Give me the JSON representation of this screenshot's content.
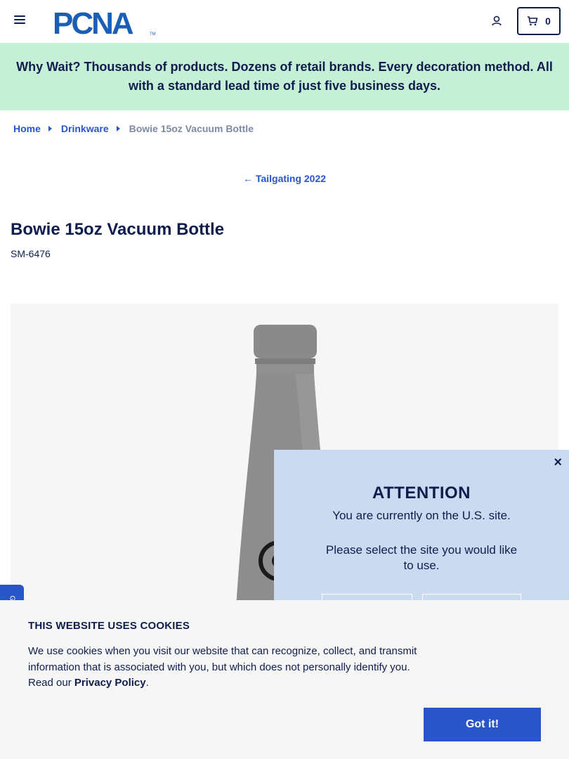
{
  "header": {
    "menu_icon": "hamburger-menu-icon",
    "logo_text": "PCNA",
    "account_icon": "user-account-icon",
    "cart_icon": "shopping-cart-icon",
    "cart_count": "0"
  },
  "banner": {
    "text": "Why Wait? Thousands of products. Dozens of retail brands. Every decoration method. All with a standard lead time of just five business days."
  },
  "breadcrumb": {
    "items": [
      "Home",
      "Drinkware"
    ],
    "current": "Bowie 15oz Vacuum Bottle"
  },
  "back_link": {
    "arrow": "←",
    "label": "Tailgating 2022"
  },
  "product": {
    "title": "Bowie 15oz Vacuum Bottle",
    "sku": "SM-6476"
  },
  "side_tab": {
    "label": "Gi"
  },
  "attention_modal": {
    "close_label": "×",
    "heading": "ATTENTION",
    "line1": "You are currently on the U.S. site.",
    "line2": "Please select the site you would like to use."
  },
  "cookie_banner": {
    "heading": "THIS WEBSITE USES COOKIES",
    "text": "We use cookies when you visit our website that can recognize, collect, and transmit information that is associated with you, but which does not personally identify you. Read our ",
    "link": "Privacy Policy",
    "suffix": ".",
    "button": "Got it!"
  },
  "colors": {
    "navy": "#0f1d4d",
    "link_blue": "#2a55c8",
    "banner_green": "#c6efd7",
    "modal_blue": "#c9daf1",
    "bottle_gray": "#8d8d8d"
  }
}
